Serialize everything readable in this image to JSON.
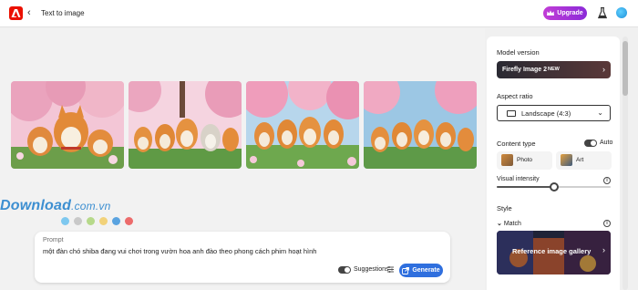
{
  "header": {
    "back_glyph": "‹",
    "title": "Text to image",
    "upgrade_label": "Upgrade"
  },
  "watermark": {
    "brand": "Download",
    "suffix": ".com.vn",
    "dot_colors": [
      "#7ec8ef",
      "#c9c9c9",
      "#b6d98a",
      "#f2d27a",
      "#5aa3e0",
      "#ec6b6b"
    ]
  },
  "prompt": {
    "label": "Prompt",
    "text": "một đàn chó shiba đang vui chơi trong vườn hoa anh đào theo phong cách phim hoạt hình",
    "suggestions_label": "Suggestions",
    "generate_label": "Generate"
  },
  "panel": {
    "model_version_heading": "Model version",
    "model_name": "Firefly Image 2",
    "model_badge": "NEW",
    "aspect_ratio_heading": "Aspect ratio",
    "aspect_ratio_value": "Landscape (4:3)",
    "content_type_heading": "Content type",
    "content_type_auto_label": "Auto",
    "content_types": [
      "Photo",
      "Art"
    ],
    "visual_intensity_heading": "Visual intensity",
    "visual_intensity_level": 0.5,
    "style_heading": "Style",
    "style_match_label": "Match",
    "reference_gallery_label": "Reference image gallery"
  },
  "colors": {
    "accent_blue": "#2f6fde",
    "adobe_red": "#eb1000",
    "upgrade_purple": "#9b2fd8"
  }
}
